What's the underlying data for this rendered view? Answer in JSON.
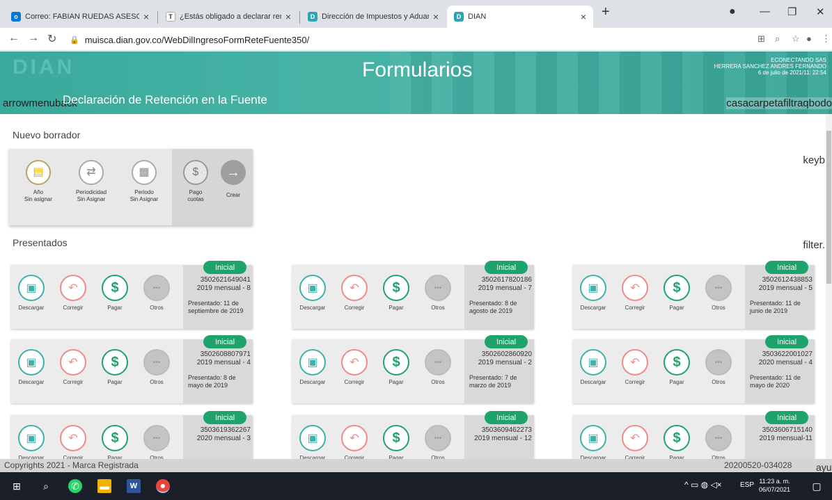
{
  "browser": {
    "tabs": [
      {
        "title": "Correo: FABIAN RUEDAS ASESOR"
      },
      {
        "title": "¿Estás obligado a declarar renta"
      },
      {
        "title": "Dirección de Impuestos y Aduan"
      },
      {
        "title": "DIAN"
      }
    ],
    "new_tab": "+",
    "url": "muisca.dian.gov.co/WebDilIngresoFormReteFuente350/"
  },
  "header": {
    "logo": "DIAN",
    "title": "Formularios",
    "subtitle": "Declaración de Retención en la Fuente",
    "left_icon_text": "arrowmenuback",
    "right_icons_text": "casacarpetafiltraqbodo",
    "user": {
      "company": "ECONECTANDO SAS",
      "name": "HERRERA SANCHEZ ANDRES FERNANDO",
      "datetime": "6 de julio de 2021/11: 22:54"
    }
  },
  "nuevo_borrador": {
    "heading": "Nuevo borrador",
    "side_text": "keyb",
    "items": [
      {
        "line1": "Año",
        "line2": "Sin asignar"
      },
      {
        "line1": "Periodicidad",
        "line2": "Sin Asignar"
      },
      {
        "line1": "Periodo",
        "line2": "Sin Asignar"
      },
      {
        "line1": "Pago",
        "line2": "cuotas"
      }
    ],
    "create_label": "Crear"
  },
  "presentados": {
    "heading": "Presentados",
    "side_text": "filter.",
    "action_labels": {
      "download": "Descargar",
      "correct": "Corregir",
      "pay": "Pagar",
      "others": "Otros"
    },
    "cards": [
      {
        "badge": "Inicial",
        "number": "3502621649041",
        "period": "2019 mensual - 8",
        "presented": "Presentado: 11 de septiembre de 2019"
      },
      {
        "badge": "Inicial",
        "number": "3502617820186",
        "period": "2019 mensual - 7",
        "presented": "Presentado: 8 de agosto de 2019"
      },
      {
        "badge": "Inicial",
        "number": "3502612438853",
        "period": "2019 mensual - 5",
        "presented": "Presentado: 11 de junio de 2019"
      },
      {
        "badge": "Inicial",
        "number": "3502608807971",
        "period": "2019 mensual - 4",
        "presented": "Presentado: 8 de mayo de 2019"
      },
      {
        "badge": "Inicial",
        "number": "3502602860920",
        "period": "2019 mensual - 2",
        "presented": "Presentado: 7 de marzo de 2019"
      },
      {
        "badge": "Inicial",
        "number": "3503622001027",
        "period": "2020 mensual - 4",
        "presented": "Presentado: 11 de mayo de 2020"
      },
      {
        "badge": "Inicial",
        "number": "3503619362267",
        "period": "2020 mensual - 3",
        "presented": ""
      },
      {
        "badge": "Inicial",
        "number": "3503609462273",
        "period": "2019 mensual - 12",
        "presented": ""
      },
      {
        "badge": "Inicial",
        "number": "3503606715140",
        "period": "2019 mensual-11",
        "presented": ""
      }
    ]
  },
  "footer": {
    "copyright": "Copyrights 2021 - Marca Registrada",
    "version": "20200520-034028",
    "side_text": "ayu"
  },
  "taskbar": {
    "language": "ESP",
    "time": "11:23 a. m.",
    "date": "06/07/2021"
  }
}
